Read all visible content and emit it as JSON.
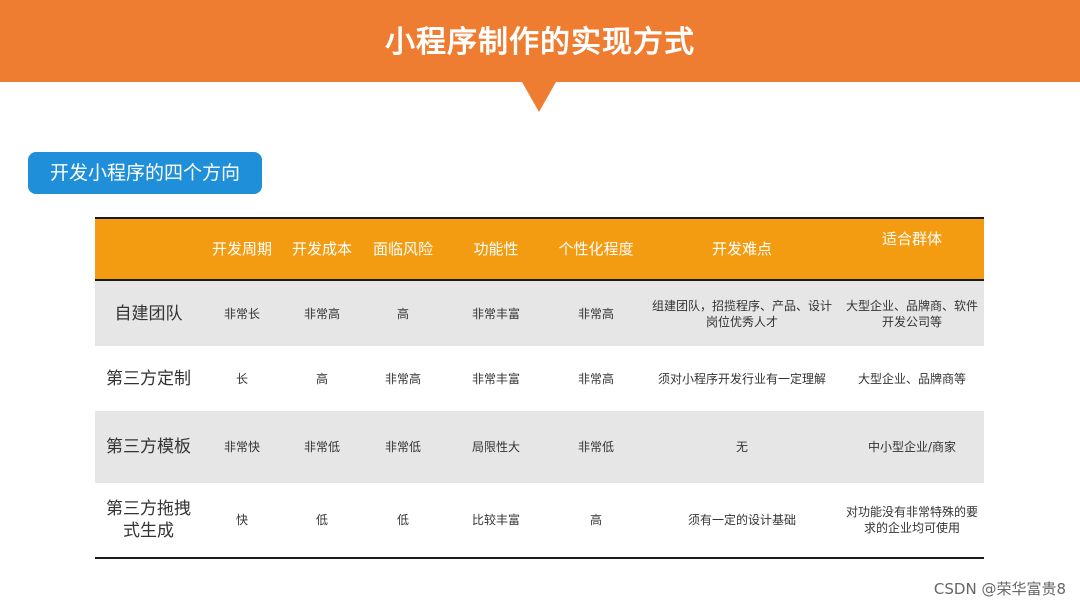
{
  "header": {
    "title": "小程序制作的实现方式"
  },
  "section": {
    "label": "开发小程序的四个方向"
  },
  "table": {
    "columns": [
      "",
      "开发周期",
      "开发成本",
      "面临风险",
      "功能性",
      "个性化程度",
      "开发难点",
      "适合群体"
    ],
    "rows": [
      [
        "自建团队",
        "非常长",
        "非常高",
        "高",
        "非常丰富",
        "非常高",
        "组建团队，招揽程序、产品、设计岗位优秀人才",
        "大型企业、品牌商、软件开发公司等"
      ],
      [
        "第三方定制",
        "长",
        "高",
        "非常高",
        "非常丰富",
        "非常高",
        "须对小程序开发行业有一定理解",
        "大型企业、品牌商等"
      ],
      [
        "第三方模板",
        "非常快",
        "非常低",
        "非常低",
        "局限性大",
        "非常低",
        "无",
        "中小型企业/商家"
      ],
      [
        "第三方拖拽式生成",
        "快",
        "低",
        "低",
        "比较丰富",
        "高",
        "须有一定的设计基础",
        "对功能没有非常特殊的要求的企业均可使用"
      ]
    ]
  },
  "watermark": {
    "text": "CSDN @荣华富贵8"
  },
  "colors": {
    "banner": "#ef7d31",
    "section_tag": "#1e8fd8",
    "table_header": "#f39c12",
    "row_shade": "#e6e6e6"
  }
}
